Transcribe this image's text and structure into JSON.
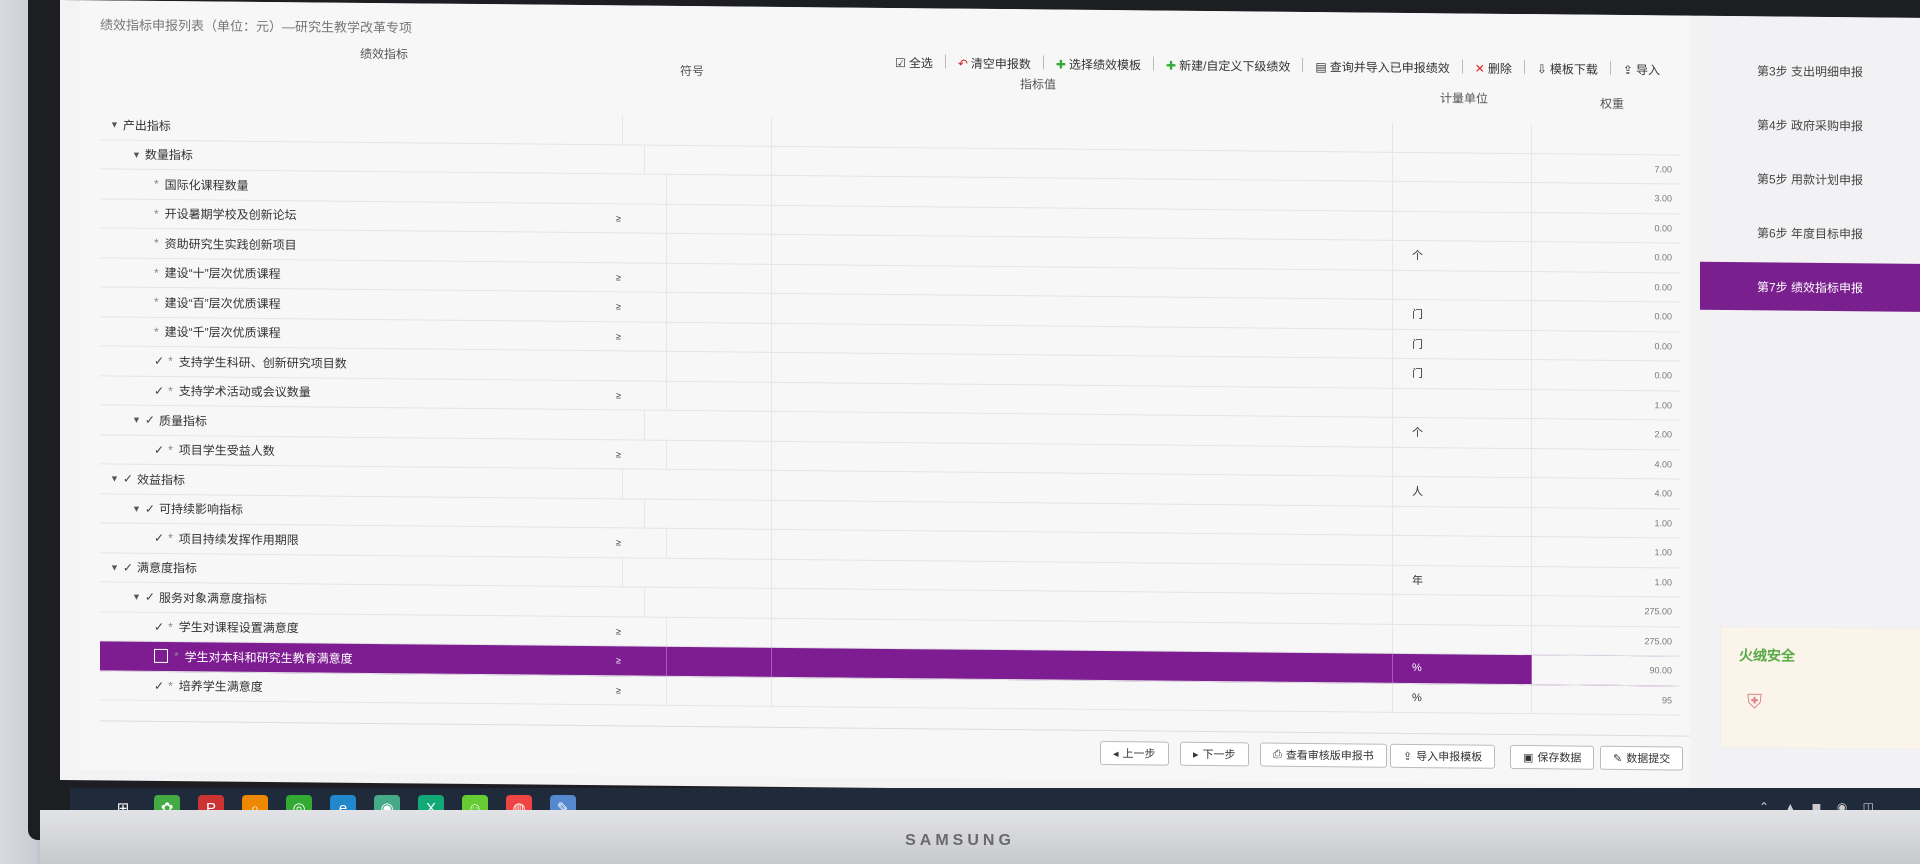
{
  "page": {
    "title": "绩效指标申报列表（单位：元）—研究生教学改革专项"
  },
  "toolbar": {
    "select_all": "全选",
    "clear": "清空申报数",
    "choose_template": "选择绩效模板",
    "new_custom": "新建/自定义下级绩效",
    "query_import": "查询并导入已申报绩效",
    "delete": "删除",
    "template_download": "模板下载",
    "import": "导入"
  },
  "columns": {
    "indicator": "绩效指标",
    "seq": "符号",
    "value": "指标值",
    "unit": "计量单位",
    "weight": "权重"
  },
  "rows": [
    {
      "label": "产出指标",
      "indent": 0,
      "type": "group",
      "expanded": true,
      "seq": "",
      "unit": "",
      "weight": ""
    },
    {
      "label": "数量指标",
      "indent": 1,
      "type": "group",
      "expanded": true,
      "seq": "",
      "unit": "",
      "weight": "7.00"
    },
    {
      "label": "国际化课程数量",
      "indent": 2,
      "type": "leaf",
      "seq": "",
      "unit": "",
      "weight": "3.00"
    },
    {
      "label": "开设暑期学校及创新论坛",
      "indent": 2,
      "type": "leaf",
      "seq": "≥",
      "unit": "",
      "weight": "0.00"
    },
    {
      "label": "资助研究生实践创新项目",
      "indent": 2,
      "type": "leaf",
      "seq": "",
      "unit": "个",
      "weight": "0.00"
    },
    {
      "label": "建设“十”层次优质课程",
      "indent": 2,
      "type": "leaf",
      "seq": "≥",
      "unit": "",
      "weight": "0.00"
    },
    {
      "label": "建设“百”层次优质课程",
      "indent": 2,
      "type": "leaf",
      "seq": "≥",
      "unit": "门",
      "weight": "0.00"
    },
    {
      "label": "建设“千”层次优质课程",
      "indent": 2,
      "type": "leaf",
      "seq": "≥",
      "unit": "门",
      "weight": "0.00"
    },
    {
      "label": "支持学生科研、创新研究项目数",
      "indent": 2,
      "type": "checked",
      "seq": "",
      "unit": "门",
      "weight": "0.00"
    },
    {
      "label": "支持学术活动或会议数量",
      "indent": 2,
      "type": "checked",
      "seq": "≥",
      "unit": "",
      "weight": "1.00"
    },
    {
      "label": "质量指标",
      "indent": 1,
      "type": "group-checked",
      "expanded": true,
      "seq": "",
      "unit": "个",
      "weight": "2.00"
    },
    {
      "label": "项目学生受益人数",
      "indent": 2,
      "type": "checked",
      "seq": "≥",
      "unit": "",
      "weight": "4.00"
    },
    {
      "label": "效益指标",
      "indent": 0,
      "type": "group-checked",
      "expanded": true,
      "seq": "",
      "unit": "人",
      "weight": "4.00"
    },
    {
      "label": "可持续影响指标",
      "indent": 1,
      "type": "group-checked",
      "expanded": true,
      "seq": "",
      "unit": "",
      "weight": "1.00"
    },
    {
      "label": "项目持续发挥作用期限",
      "indent": 2,
      "type": "checked",
      "seq": "≥",
      "unit": "",
      "weight": "1.00"
    },
    {
      "label": "满意度指标",
      "indent": 0,
      "type": "group-checked",
      "expanded": true,
      "seq": "",
      "unit": "年",
      "weight": "1.00"
    },
    {
      "label": "服务对象满意度指标",
      "indent": 1,
      "type": "group-checked",
      "expanded": true,
      "seq": "",
      "unit": "",
      "weight": "275.00"
    },
    {
      "label": "学生对课程设置满意度",
      "indent": 2,
      "type": "checked",
      "seq": "≥",
      "unit": "",
      "weight": "275.00"
    },
    {
      "label": "学生对本科和研究生教育满意度",
      "indent": 2,
      "type": "selected",
      "seq": "≥",
      "unit": "%",
      "weight": "90.00"
    },
    {
      "label": "培养学生满意度",
      "indent": 2,
      "type": "checked",
      "seq": "≥",
      "unit": "%",
      "weight": "95"
    }
  ],
  "footer": {
    "prev": "上一步",
    "next": "下一步",
    "view_report": "查看审核版申报书",
    "import_template": "导入申报模板",
    "save": "保存数据",
    "submit": "数据提交"
  },
  "steps": [
    {
      "label": "第3步 支出明细申报",
      "active": false
    },
    {
      "label": "第4步 政府采购申报",
      "active": false
    },
    {
      "label": "第5步 用款计划申报",
      "active": false
    },
    {
      "label": "第6步 年度目标申报",
      "active": false
    },
    {
      "label": "第7步 绩效指标申报",
      "active": true
    }
  ],
  "popup": {
    "title": "火绒安全"
  },
  "monitor": {
    "brand": "SAMSUNG"
  },
  "colors": {
    "accent": "#7e1c92",
    "active_step": "#7a1f8e",
    "taskbar": "#1f2a3a"
  },
  "taskbar_icons": [
    "windows-start-icon",
    "app-icon",
    "powerpoint-icon",
    "search-icon",
    "wechat-icon",
    "edge-icon",
    "chrome-icon",
    "excel-icon",
    "green-app-icon",
    "browser-icon",
    "notes-icon"
  ]
}
